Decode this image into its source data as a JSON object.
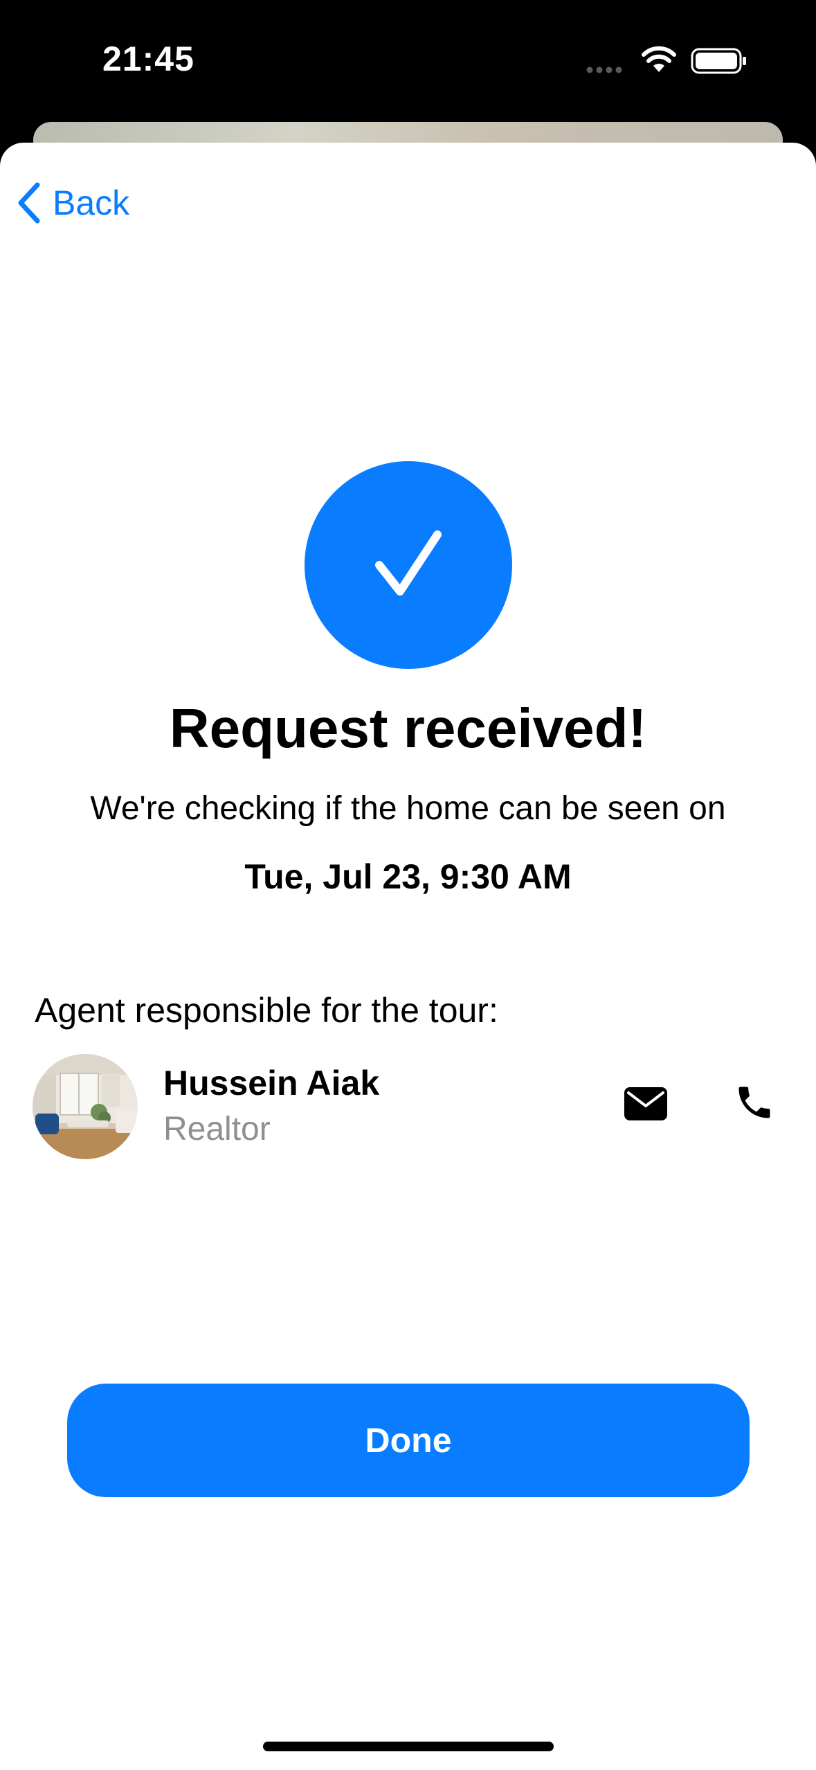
{
  "status_bar": {
    "time": "21:45"
  },
  "nav": {
    "back_label": "Back"
  },
  "confirmation": {
    "title": "Request received!",
    "subtitle": "We're checking if the home can be seen on",
    "datetime": "Tue, Jul 23, 9:30 AM"
  },
  "agent": {
    "heading": "Agent responsible for the tour:",
    "name": "Hussein Aiak",
    "role": "Realtor"
  },
  "actions": {
    "done_label": "Done"
  },
  "icons": {
    "back": "chevron-left-icon",
    "check": "checkmark-icon",
    "mail": "envelope-icon",
    "phone": "phone-icon",
    "wifi": "wifi-icon",
    "battery": "battery-icon"
  },
  "colors": {
    "accent": "#0a7cff",
    "secondary_text": "#8e8e93"
  }
}
